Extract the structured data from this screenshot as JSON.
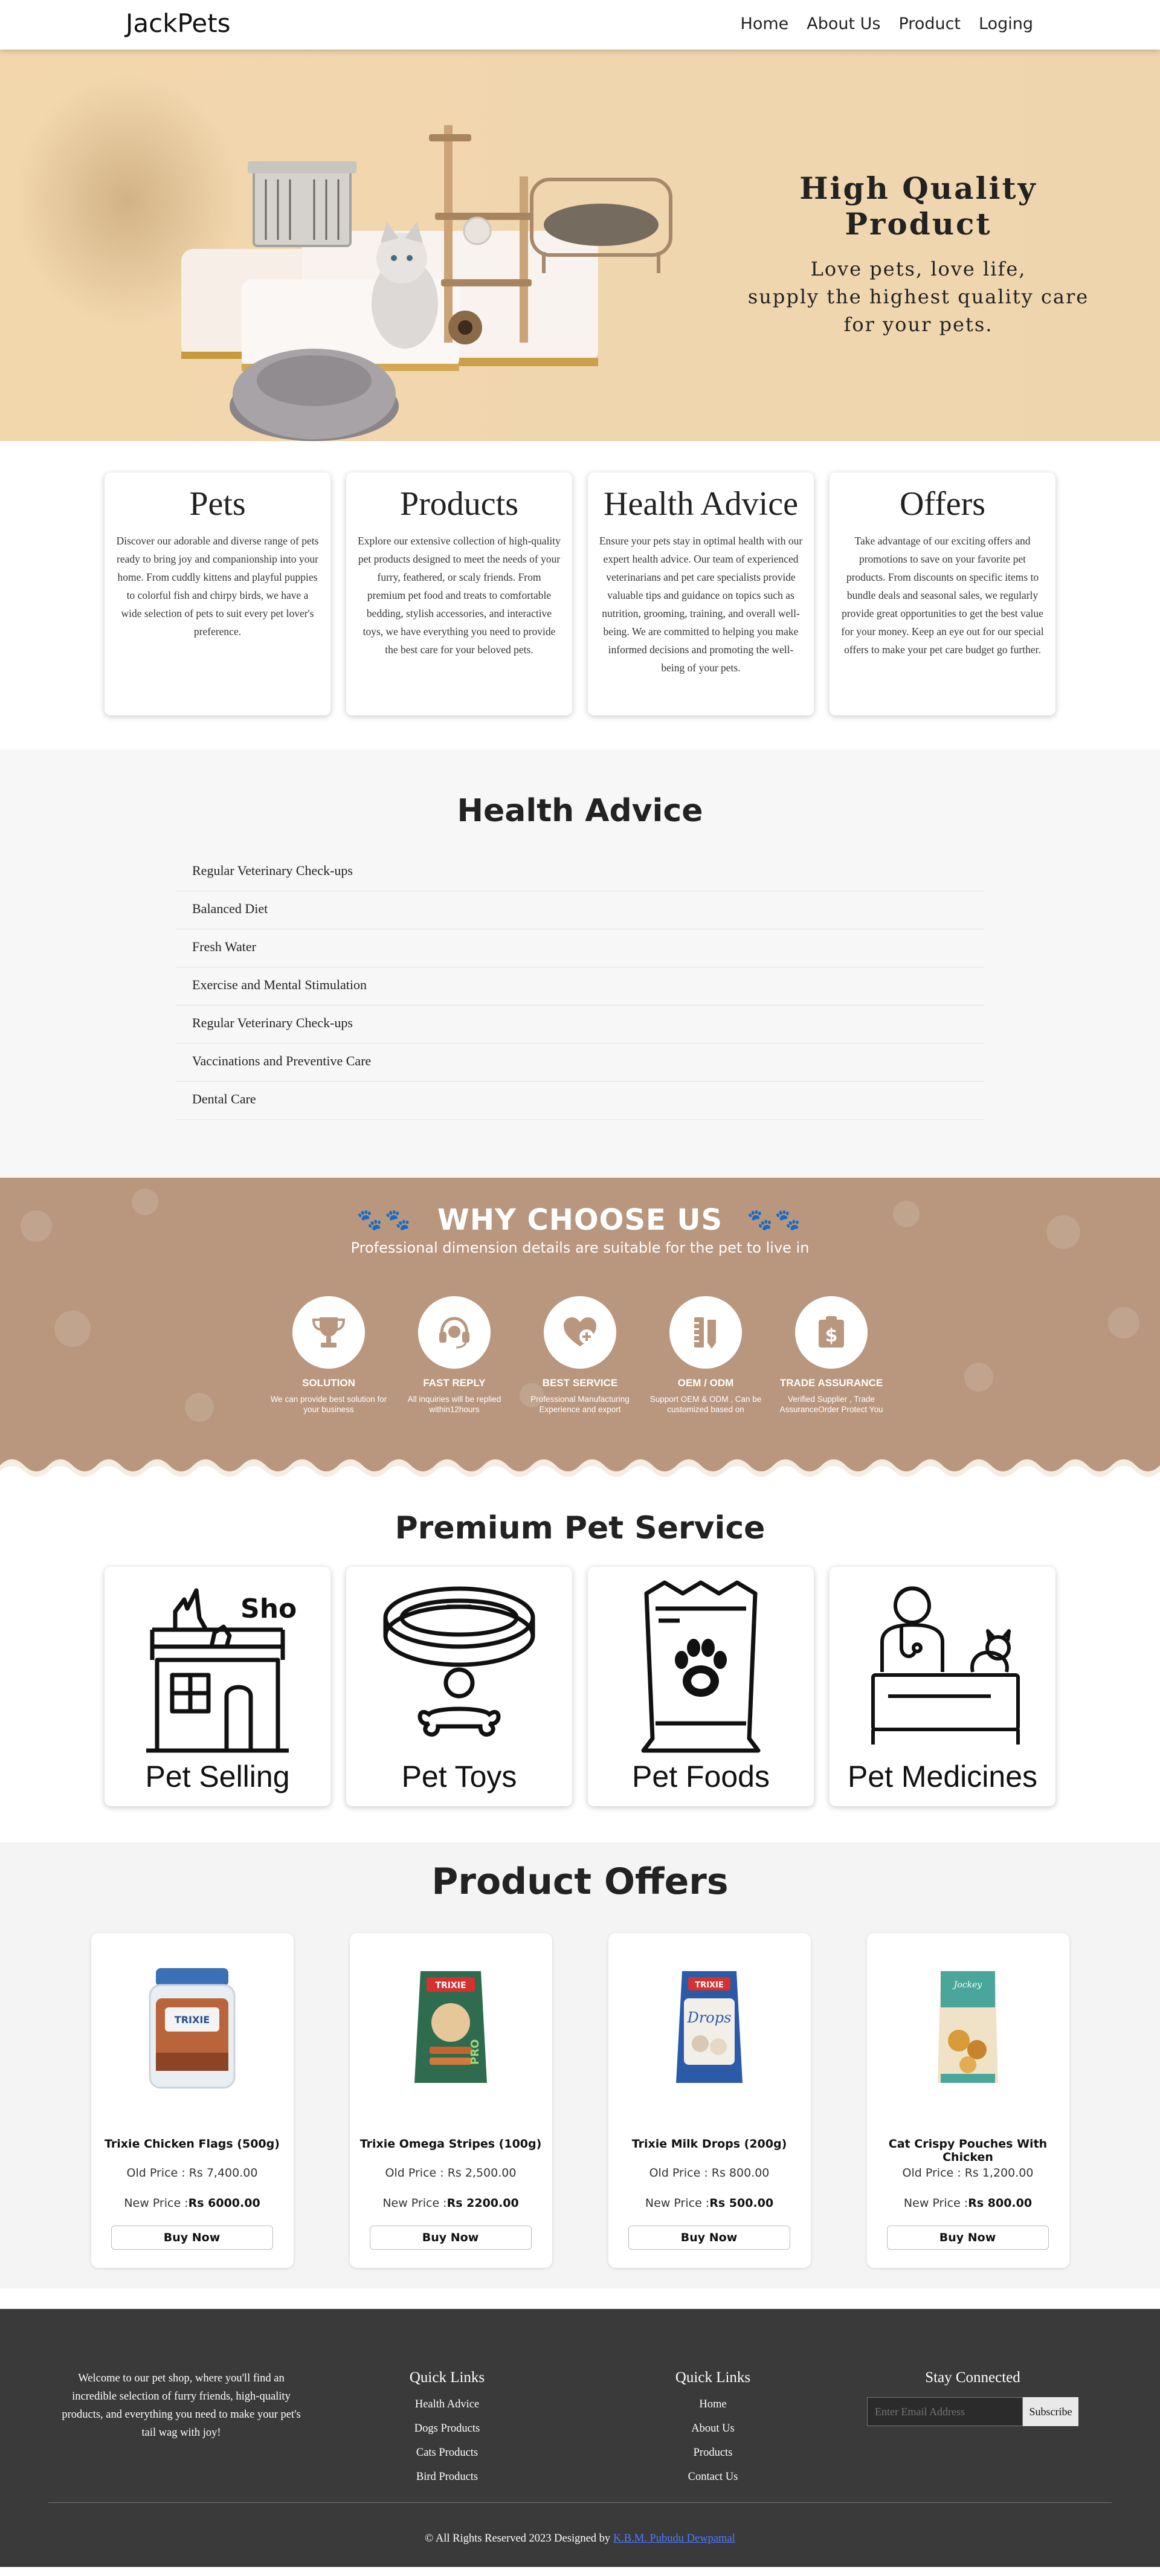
{
  "nav": {
    "brand": "JackPets",
    "links": [
      "Home",
      "About Us",
      "Product",
      "Loging"
    ]
  },
  "hero": {
    "title": "High Quality Product",
    "line1": "Love pets, love life,",
    "line2": "supply the highest quality care",
    "line3": "for your pets."
  },
  "intro": [
    {
      "title": "Pets",
      "text": "Discover our adorable and diverse range of pets ready to bring joy and companionship into your home. From cuddly kittens and playful puppies to colorful fish and chirpy birds, we have a wide selection of pets to suit every pet lover's preference."
    },
    {
      "title": "Products",
      "text": "Explore our extensive collection of high-quality pet products designed to meet the needs of your furry, feathered, or scaly friends. From premium pet food and treats to comfortable bedding, stylish accessories, and interactive toys, we have everything you need to provide the best care for your beloved pets."
    },
    {
      "title": "Health Advice",
      "text": "Ensure your pets stay in optimal health with our expert health advice. Our team of experienced veterinarians and pet care specialists provide valuable tips and guidance on topics such as nutrition, grooming, training, and overall well-being. We are committed to helping you make informed decisions and promoting the well-being of your pets."
    },
    {
      "title": "Offers",
      "text": "Take advantage of our exciting offers and promotions to save on your favorite pet products. From discounts on specific items to bundle deals and seasonal sales, we regularly provide great opportunities to get the best value for your money. Keep an eye out for our special offers to make your pet care budget go further."
    }
  ],
  "health": {
    "title": "Health Advice",
    "items": [
      "Regular Veterinary Check-ups",
      "Balanced Diet",
      "Fresh Water",
      "Exercise and Mental Stimulation",
      "Regular Veterinary Check-ups",
      "Vaccinations and Preventive Care",
      "Dental Care"
    ]
  },
  "why": {
    "title": "WHY CHOOSE US",
    "subtitle": "Professional dimension details are suitable for the pet to live in",
    "items": [
      {
        "icon": "trophy-icon",
        "title": "SOLUTION",
        "text": "We can provide best solution for your business"
      },
      {
        "icon": "headset-icon",
        "title": "FAST REPLY",
        "text": "All inquiries will be replied within12hours"
      },
      {
        "icon": "heart-plus-icon",
        "title": "BEST SERVICE",
        "text": "Professional Manufacturing Experience and export"
      },
      {
        "icon": "ruler-pencil-icon",
        "title": "OEM / ODM",
        "text": "Support OEM & ODM , Can be customized based on"
      },
      {
        "icon": "dollar-shield-icon",
        "title": "TRADE ASSURANCE",
        "text": "Verified Supplier , Trade AssuranceOrder Protect You"
      }
    ]
  },
  "premium": {
    "title": "Premium Pet Service",
    "shop_sign": "Shop",
    "items": [
      {
        "icon": "pet-shop-icon",
        "label": "Pet Selling"
      },
      {
        "icon": "pet-collar-icon",
        "label": "Pet Toys"
      },
      {
        "icon": "pet-food-bag-icon",
        "label": "Pet Foods"
      },
      {
        "icon": "veterinarian-icon",
        "label": "Pet Medicines"
      }
    ]
  },
  "offers": {
    "title": "Product Offers",
    "old_prefix": "Old Price : ",
    "new_prefix": "New Price :",
    "buy_label": "Buy Now",
    "items": [
      {
        "name": "Trixie Chicken Flags (500g)",
        "old": "Rs 7,400.00",
        "new": "Rs 6000.00",
        "color": "#3b6fb6"
      },
      {
        "name": "Trixie Omega Stripes (100g)",
        "old": "Rs 2,500.00",
        "new": "Rs 2200.00",
        "color": "#2f6b4e"
      },
      {
        "name": "Trixie Milk Drops (200g)",
        "old": "Rs 800.00",
        "new": "Rs 500.00",
        "color": "#2a5aa8"
      },
      {
        "name": "Cat Crispy Pouches With Chicken",
        "old": "Rs 1,200.00",
        "new": "Rs 800.00",
        "color": "#4aa69a"
      }
    ],
    "pack_texts": {
      "trixie": "TRIXIE",
      "pro": "PRO",
      "drops": "Drops",
      "pouch": "Jockey"
    }
  },
  "footer": {
    "about": "Welcome to our pet shop, where you'll find an incredible selection of furry friends, high-quality products, and everything you need to make your pet's tail wag with joy!",
    "col1": {
      "title": "Quick Links",
      "links": [
        "Health Advice",
        "Dogs Products",
        "Cats Products",
        "Bird Products"
      ]
    },
    "col2": {
      "title": "Quick Links",
      "links": [
        "Home",
        "About Us",
        "Products",
        "Contact Us"
      ]
    },
    "stay": {
      "title": "Stay Connected",
      "placeholder": "Enter Email Address",
      "button": "Subscribe"
    },
    "copyright": "© All Rights Reserved 2023 Designed by ",
    "designer": "K.B.M. Pubudu Dewpamal"
  },
  "colors": {
    "hero_bg": "#f0d6ae",
    "why_bg": "#b8977e",
    "footer_bg": "#3a3a3a",
    "link": "#4a7bff"
  }
}
